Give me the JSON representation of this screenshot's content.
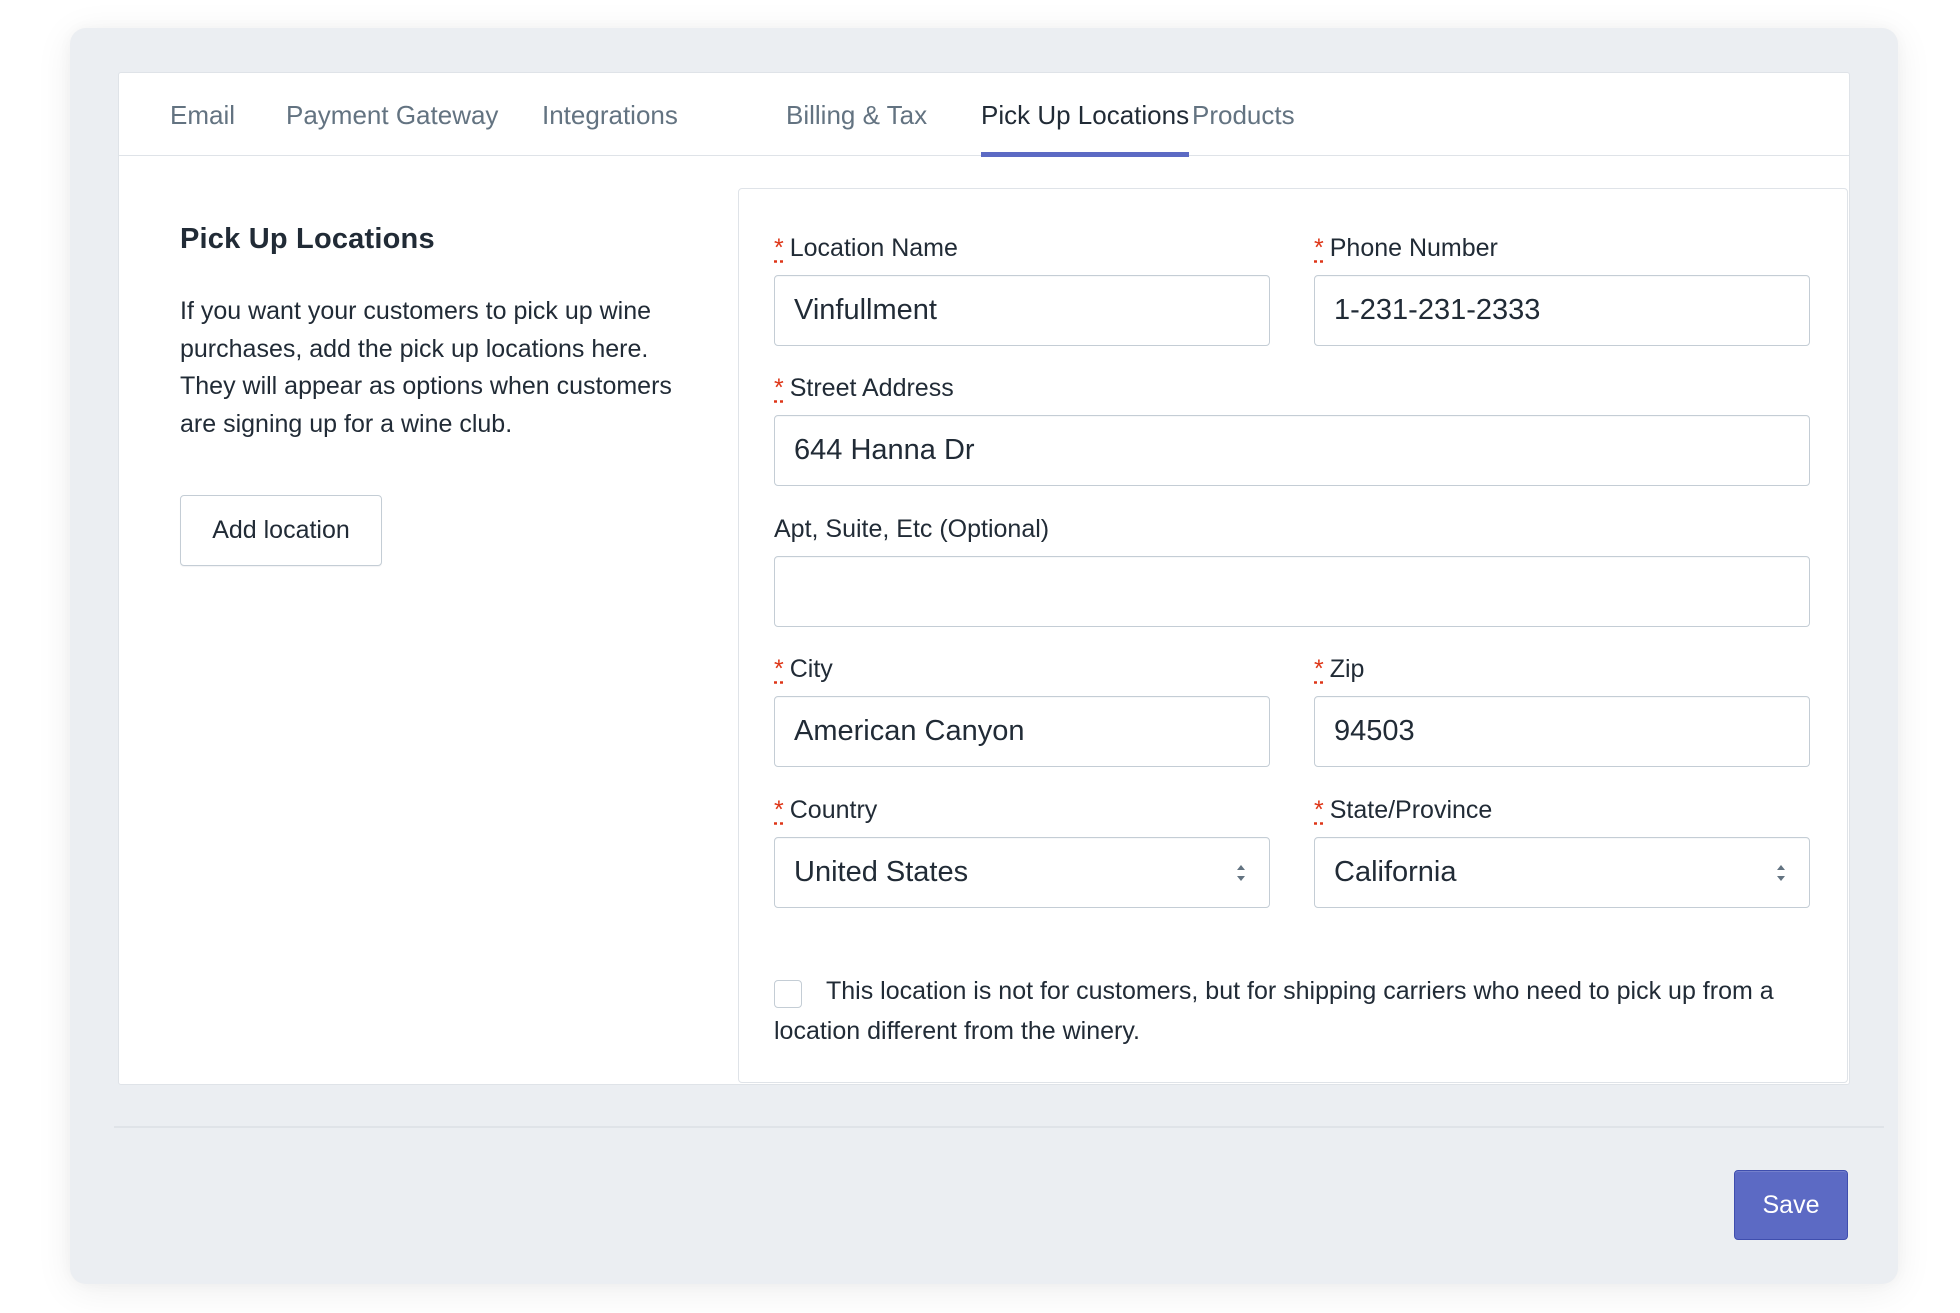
{
  "tabs": [
    {
      "label": "Email"
    },
    {
      "label": "Payment Gateway"
    },
    {
      "label": "Integrations"
    },
    {
      "label": "Billing & Tax"
    },
    {
      "label": "Pick Up Locations",
      "active": true
    },
    {
      "label": "Products"
    }
  ],
  "sidebar": {
    "title": "Pick Up Locations",
    "description": "If you want your customers to pick up wine purchases, add the pick up locations here. They will appear as options when customers are signing up for a wine club.",
    "add_button": "Add location"
  },
  "form": {
    "required_marker": "*",
    "location_name": {
      "label": "Location Name",
      "value": "Vinfullment"
    },
    "phone_number": {
      "label": "Phone Number",
      "value": "1-231-231-2333"
    },
    "street_address": {
      "label": "Street Address",
      "value": "644 Hanna Dr"
    },
    "apt": {
      "label": "Apt, Suite, Etc (Optional)",
      "value": ""
    },
    "city": {
      "label": "City",
      "value": "American Canyon"
    },
    "zip": {
      "label": "Zip",
      "value": "94503"
    },
    "country": {
      "label": "Country",
      "value": "United States"
    },
    "state": {
      "label": "State/Province",
      "value": "California"
    },
    "carrier_checkbox": {
      "checked": false,
      "label": "This location is not for customers, but for shipping carriers who need to pick up from a location different from the winery."
    }
  },
  "footer": {
    "save_label": "Save"
  },
  "colors": {
    "accent": "#5c6ac4",
    "required": "#de3618",
    "border": "#c4cdd5",
    "background": "#ebeef2"
  }
}
